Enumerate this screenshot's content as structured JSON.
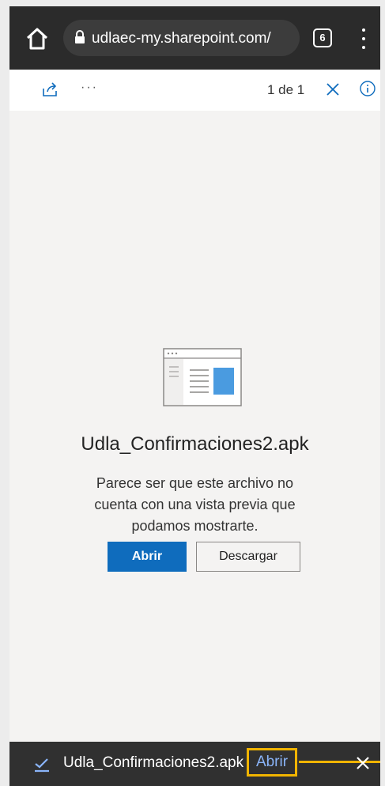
{
  "browser": {
    "url": "udlaec-my.sharepoint.com/",
    "tab_count": "6"
  },
  "viewer": {
    "page_counter": "1 de 1"
  },
  "preview": {
    "file_name": "Udla_Confirmaciones2.apk",
    "message": "Parece ser que este archivo no cuenta con una vista previa que podamos mostrarte.",
    "open_label": "Abrir",
    "download_label": "Descargar"
  },
  "download_bar": {
    "file_name": "Udla_Confirmaciones2.apk",
    "open_label": "Abrir"
  },
  "colors": {
    "accent": "#0f6cbd",
    "highlight": "#f1b400",
    "link": "#8ab4f8"
  }
}
